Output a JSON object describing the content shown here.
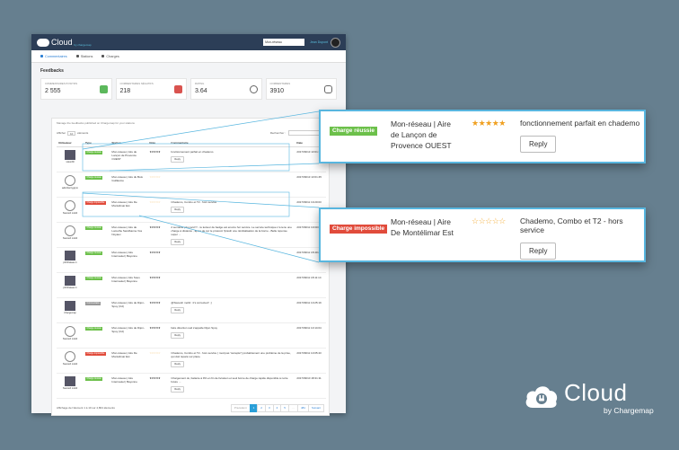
{
  "app": {
    "logo": "Cloud",
    "logo_sub": "by chargemap",
    "network_select": "Mon-réseau",
    "user": "Jean Dupont"
  },
  "nav": [
    {
      "label": "Commentaires",
      "active": true
    },
    {
      "label": "Stations",
      "active": false
    },
    {
      "label": "Charges",
      "active": false
    }
  ],
  "page_title": "Feedbacks",
  "stats": [
    {
      "label": "Commentaires positifs",
      "value": "2 555",
      "icon": "thumbs-up-icon"
    },
    {
      "label": "Commentaires négatifs",
      "value": "218",
      "icon": "thumbs-down-icon"
    },
    {
      "label": "Rating",
      "value": "3.64",
      "icon": "smiley-icon"
    },
    {
      "label": "Commentaires",
      "value": "3910",
      "icon": "chat-icon"
    }
  ],
  "panel_note": "Manage the feedbacks published on Chargemap for your stations",
  "controls": {
    "show": "Afficher",
    "count": "10",
    "entries": "éléments",
    "search": "Rechercher :"
  },
  "table": {
    "headers": [
      "Utilisateur",
      "Type",
      "Station",
      "Note",
      "Commentaire",
      "Date"
    ],
    "rows": [
      {
        "user": "visionfill",
        "type": "Charge réussie",
        "type_color": "green",
        "station": "Mon-réseau | Aire de Lançon de Provence OUEST",
        "stars": "★★★★★",
        "empty": false,
        "comment": "fonctionnement parfait en chademo",
        "reply": "Reply",
        "date": "2017/09/13 13:01:11",
        "avatar": "img"
      },
      {
        "user": "adk.thierrygrpm",
        "type": "Charge réussie",
        "type_color": "green",
        "station": "Mon-réseau | Aire du Bois Guillaume",
        "stars": "☆☆☆☆☆",
        "empty": true,
        "comment": "",
        "reply": "",
        "date": "2017/09/13 13:01:45",
        "avatar": "face"
      },
      {
        "user": "Swoosh mobil",
        "type": "Charge impossible",
        "type_color": "red",
        "station": "Mon-réseau | Aire De Montélimar Est",
        "stars": "☆☆☆☆☆",
        "empty": true,
        "comment": "Chademo, Combo et T2 - hors service",
        "reply": "Reply",
        "date": "2017/09/11 19:20:03",
        "avatar": "face"
      },
      {
        "user": "Swoosh mobil",
        "type": "Charge réussie",
        "type_color": "green",
        "station": "Mon-réseau | Aire de Lamothe Sandbanne Vos Noyaux",
        "stars": "★★★★★",
        "empty": false,
        "comment": "2 semaine plus tard !!! - le lecteur de badge est enocre hor service. Le service technique n'a tenu une charge à distance , après de sur le protocol !!pissilr une réinitialisation de la borne - Belle réponse super ...",
        "reply": "Reply",
        "date": "2017/09/11 19:00:03",
        "avatar": "face"
      },
      {
        "user": "pfcChateau 1",
        "type": "Charge réussie",
        "type_color": "green",
        "station": "Mon-réseau | Aire Internautel | Bayonne",
        "stars": "★★★★★",
        "empty": false,
        "comment": "",
        "reply": "",
        "date": "2017/09/11 18:40:20",
        "avatar": "img"
      },
      {
        "user": "pfcChateau 1",
        "type": "Charge réussie",
        "type_color": "green",
        "station": "Mon-réseau | Aire Sous Internautel | Bayonne",
        "stars": "★★★★★",
        "empty": false,
        "comment": "",
        "reply": "",
        "date": "2017/09/11 18:11:14",
        "avatar": "img"
      },
      {
        "user": "Chargemap",
        "type": "Commentaire",
        "type_color": "grey",
        "station": "Mon-réseau | Aire de Dijon-Spoy (Cd)",
        "stars": "★★★★★",
        "empty": false,
        "comment": "@Swoosh mobil : it's corrected ! ;)",
        "reply": "Reply",
        "date": "2017/09/11 10:25:19",
        "avatar": "img"
      },
      {
        "user": "Swoosh mobil",
        "type": "Charge réussie",
        "type_color": "green",
        "station": "Mon-réseau | Aire de Dijon-Spoy (Cd)",
        "stars": "★★★★★",
        "empty": false,
        "comment": "faire direction sud s'appelle Dijon Spoy",
        "reply": "Reply",
        "date": "2017/09/11 10:14:04",
        "avatar": "face"
      },
      {
        "user": "Swoosh mobil",
        "type": "Charge impossible",
        "type_color": "red",
        "station": "Mon-réseau | Aire De Montélimar Est",
        "stars": "☆☆☆☆☆",
        "empty": true,
        "comment": "Chademo, Combo et T2 - hors service ( mod pas \"accepté\") probablement une problème de la prise, qui doit réparé sur place.",
        "reply": "Reply",
        "date": "2017/09/11 10:05:43",
        "avatar": "face"
      },
      {
        "user": "Swoosh mobil",
        "type": "Charge réussie",
        "type_color": "green",
        "station": "Mon-réseau | Aire Internautel | Bayonne",
        "stars": "★★★★★",
        "empty": false,
        "comment": "Chargement ok, batterie à 9% en fin de livraison et seul borne de charge rapide disponible à notre future ...",
        "reply": "Reply",
        "date": "2017/09/10 18:31:11",
        "avatar": "img"
      }
    ]
  },
  "footer": {
    "info": "Affichage de l'élément 1 à 10 sur 4,804 éléments",
    "pages": [
      "Précédent",
      "1",
      "2",
      "3",
      "4",
      "5",
      "…",
      "481",
      "Suivant"
    ]
  },
  "callouts": [
    {
      "type": "Charge réussie",
      "station": "Mon-réseau | Aire de Lançon de Provence OUEST",
      "stars": "★★★★★",
      "comment": "fonctionnement parfait en chademo",
      "reply": "Reply"
    },
    {
      "type": "Charge impossible",
      "station": "Mon-réseau | Aire De Montélimar Est",
      "stars": "☆☆☆☆☆",
      "comment": "Chademo, Combo et T2 - hors service",
      "reply": "Reply"
    }
  ],
  "brand": {
    "name": "Cloud",
    "by": "by Chargemap"
  },
  "colors": {
    "background": "#667f8f",
    "topbar": "#2c3e57",
    "accent": "#58b6df",
    "success": "#6cc04a",
    "danger": "#e14b3b",
    "star": "#f0a020"
  }
}
